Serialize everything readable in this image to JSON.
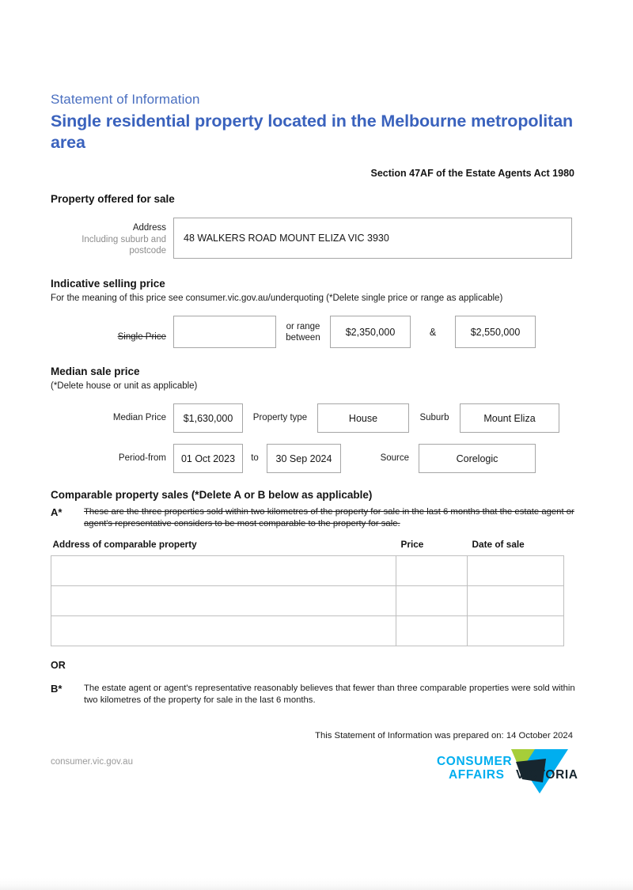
{
  "header": {
    "kicker": "Statement of Information",
    "title": "Single residential property located in the Melbourne metropolitan area",
    "section_reference": "Section 47AF of the Estate Agents Act 1980"
  },
  "property_offered": {
    "heading": "Property offered for sale",
    "address_label": "Address",
    "address_sublabel": "Including suburb and postcode",
    "address_value": "48 WALKERS ROAD MOUNT ELIZA VIC 3930"
  },
  "indicative_price": {
    "heading": "Indicative selling price",
    "note": "For the meaning of this price see consumer.vic.gov.au/underquoting (*Delete single price or range as applicable)",
    "single_price_label": "Single Price",
    "single_price_value": "",
    "or_range_label": "or range between",
    "range_low": "$2,350,000",
    "ampersand": "&",
    "range_high": "$2,550,000"
  },
  "median_price": {
    "heading": "Median sale price",
    "note": "(*Delete house or unit as applicable)",
    "median_price_label": "Median Price",
    "median_price_value": "$1,630,000",
    "property_type_label": "Property type",
    "property_type_value": "House",
    "suburb_label": "Suburb",
    "suburb_value": "Mount Eliza",
    "period_from_label": "Period-from",
    "period_from_value": "01 Oct 2023",
    "to_label": "to",
    "period_to_value": "30 Sep 2024",
    "source_label": "Source",
    "source_value": "Corelogic"
  },
  "comparable_sales": {
    "heading": "Comparable property sales (*Delete A or B below as applicable)",
    "option_a_marker": "A*",
    "option_a_text": "These are the three properties sold within two kilometres of the property for sale in the last 6 months that the estate agent or agent's representative considers to be most comparable to the property for sale.",
    "table_headers": {
      "address": "Address of comparable property",
      "price": "Price",
      "date": "Date of sale"
    },
    "rows": [
      {
        "address": "",
        "price": "",
        "date": ""
      },
      {
        "address": "",
        "price": "",
        "date": ""
      },
      {
        "address": "",
        "price": "",
        "date": ""
      }
    ],
    "or_label": "OR",
    "option_b_marker": "B*",
    "option_b_text": "The estate agent or agent's representative reasonably believes that fewer than three comparable properties were sold within two kilometres of the property for sale in the last 6 months."
  },
  "prepared_statement": "This Statement of Information was prepared on: 14 October 2024",
  "footer": {
    "url": "consumer.vic.gov.au",
    "logo": {
      "line1": "CONSUMER",
      "line2": "AFFAIRS",
      "line3": "VICTORIA",
      "cyan": "#00AEEF",
      "green": "#A6CE39",
      "navy": "#17262F"
    }
  }
}
